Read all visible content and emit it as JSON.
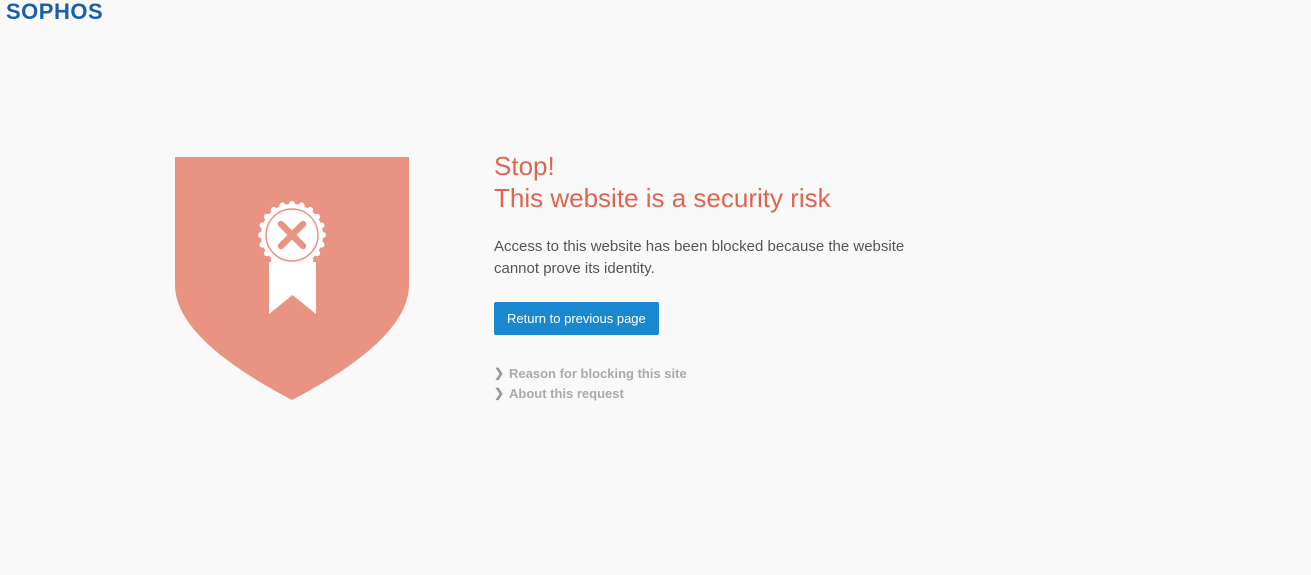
{
  "brand": {
    "logo_text": "SOPHOS"
  },
  "alert": {
    "title_line1": "Stop!",
    "title_line2": "This website is a security risk",
    "description": "Access to this website has been blocked because the website cannot prove its identity."
  },
  "actions": {
    "return_label": "Return to previous page"
  },
  "details": [
    {
      "label": "Reason for blocking this site",
      "icon": "chevron-right-icon"
    },
    {
      "label": "About this request",
      "icon": "chevron-right-icon"
    }
  ],
  "colors": {
    "accent": "#e0654f",
    "shield": "#e99383",
    "button": "#1a88d0",
    "brand": "#1a5fa8"
  }
}
